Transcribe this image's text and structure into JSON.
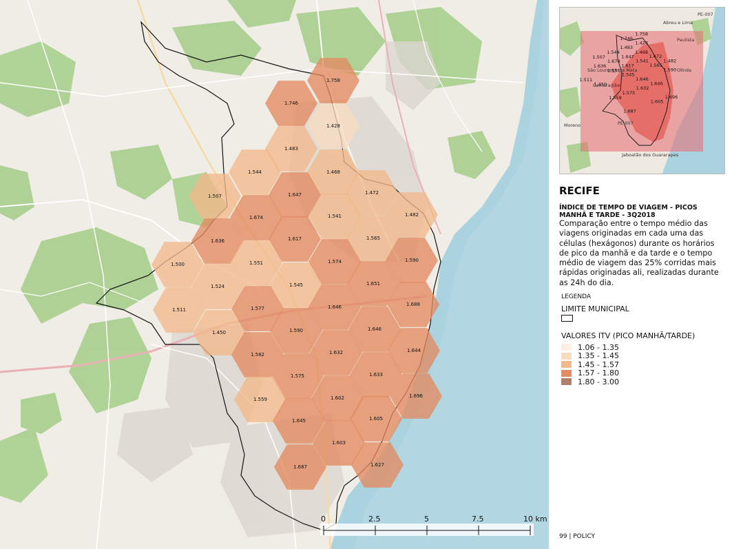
{
  "title": "RECIFE",
  "subtitle": "ÍNDICE DE TEMPO DE VIAGEM - PICOS MANHÃ E TARDE - 3Q2018",
  "description": "Comparação entre o tempo médio das viagens originadas em cada uma das células (hexágonos) durante os horários de pico da manhã e da tarde e o tempo médio de viagem das 25% corridas mais rápidas originadas ali, realizadas durante as 24h do dia.",
  "legend": {
    "heading": "LEGENDA",
    "limit_label": "LIMITE MUNICIPAL",
    "values_title": "VALORES ITV (PICO MANHÃ/TARDE)",
    "classes": [
      {
        "label": "1.06 - 1.35",
        "color": "#fbeee3"
      },
      {
        "label": "1.35 - 1.45",
        "color": "#f8dcc0"
      },
      {
        "label": "1.45 - 1.57",
        "color": "#f2b98a"
      },
      {
        "label": "1.57 - 1.80",
        "color": "#e38a60"
      },
      {
        "label": "1.80 - 3.00",
        "color": "#b0806d"
      }
    ]
  },
  "hexagons": [
    {
      "value": "1.758",
      "cls": 3
    },
    {
      "value": "1.746",
      "cls": 3
    },
    {
      "value": "1.428",
      "cls": 1
    },
    {
      "value": "1.483",
      "cls": 2
    },
    {
      "value": "1.544",
      "cls": 2
    },
    {
      "value": "1.468",
      "cls": 2
    },
    {
      "value": "1.507",
      "cls": 2
    },
    {
      "value": "1.647",
      "cls": 3
    },
    {
      "value": "1.472",
      "cls": 2
    },
    {
      "value": "1.674",
      "cls": 3
    },
    {
      "value": "1.541",
      "cls": 2
    },
    {
      "value": "1.482",
      "cls": 2
    },
    {
      "value": "1.636",
      "cls": 3
    },
    {
      "value": "1.617",
      "cls": 3
    },
    {
      "value": "1.565",
      "cls": 2
    },
    {
      "value": "1.500",
      "cls": 2
    },
    {
      "value": "1.551",
      "cls": 2
    },
    {
      "value": "1.574",
      "cls": 3
    },
    {
      "value": "1.590",
      "cls": 3
    },
    {
      "value": "1.524",
      "cls": 2
    },
    {
      "value": "1.545",
      "cls": 2
    },
    {
      "value": "1.651",
      "cls": 3
    },
    {
      "value": "1.511",
      "cls": 2
    },
    {
      "value": "1.577",
      "cls": 3
    },
    {
      "value": "1.646",
      "cls": 3
    },
    {
      "value": "1.688",
      "cls": 3
    },
    {
      "value": "1.450",
      "cls": 2
    },
    {
      "value": "1.590",
      "cls": 3
    },
    {
      "value": "1.646",
      "cls": 3
    },
    {
      "value": "1.582",
      "cls": 3
    },
    {
      "value": "1.632",
      "cls": 3
    },
    {
      "value": "1.644",
      "cls": 3
    },
    {
      "value": "1.575",
      "cls": 3
    },
    {
      "value": "1.633",
      "cls": 3
    },
    {
      "value": "1.559",
      "cls": 2
    },
    {
      "value": "1.602",
      "cls": 3
    },
    {
      "value": "1.696",
      "cls": 3
    },
    {
      "value": "1.645",
      "cls": 3
    },
    {
      "value": "1.605",
      "cls": 3
    },
    {
      "value": "1.603",
      "cls": 3
    },
    {
      "value": "1.687",
      "cls": 3
    },
    {
      "value": "1.627",
      "cls": 3
    }
  ],
  "inset": {
    "places": [
      "Abreu e Lima",
      "Paulista",
      "São Lourenço da Mata",
      "Camaragibe",
      "Olinda",
      "Moreno",
      "Jaboatão dos Guararapes",
      "PE-007",
      "PE-007"
    ]
  },
  "scale_bar": {
    "ticks": [
      "0",
      "2.5",
      "5",
      "7.5",
      "10 km"
    ]
  },
  "footer": "99 | POLICY"
}
